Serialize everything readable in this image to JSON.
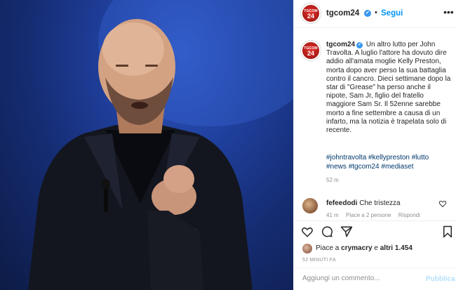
{
  "post": {
    "account": "tgcom24",
    "logo_text": "TGCOM",
    "logo_number": "24",
    "follow_label": "Segui",
    "more_label": "•••",
    "dot": "•",
    "verified_mark": "✔",
    "caption": "Un altro lutto per John Travolta. A luglio l'attore ha dovuto dire addio all'amata moglie Kelly Preston, morta dopo aver perso la sua battaglia contro il cancro. Dieci settimane dopo la star di \"Grease\" ha perso anche il nipote, Sam Jr, figlio del fratello maggiore Sam Sr. Il 52enne sarebbe morto a fine settembre a causa di un infarto, ma la notizia è trapelata solo di recente.",
    "hashtags": [
      "#johntravolta",
      "#kellypreston",
      "#lutto",
      "#news",
      "#tgcom24",
      "#mediaset"
    ],
    "caption_time": "52 m"
  },
  "comment": {
    "user": "fefeedodi",
    "text": "Che tristezza",
    "time": "41 m",
    "likes": "Piace a 2 persone",
    "reply": "Rispondi"
  },
  "actions": {
    "icons": [
      "heart-icon",
      "comment-icon",
      "share-icon",
      "save-icon"
    ],
    "likes_prefix": "Piace a",
    "likes_user": "crymacry",
    "likes_middle": "e",
    "likes_count": "altri 1.454",
    "post_time": "52 MINUTI FA"
  },
  "comment_box": {
    "placeholder": "Aggiungi un commento...",
    "publish_label": "Pubblica"
  },
  "colors": {
    "accent": "#0095f6",
    "verified": "#3897f0",
    "hashtag": "#00376b",
    "logo_red": "#e6322b"
  }
}
